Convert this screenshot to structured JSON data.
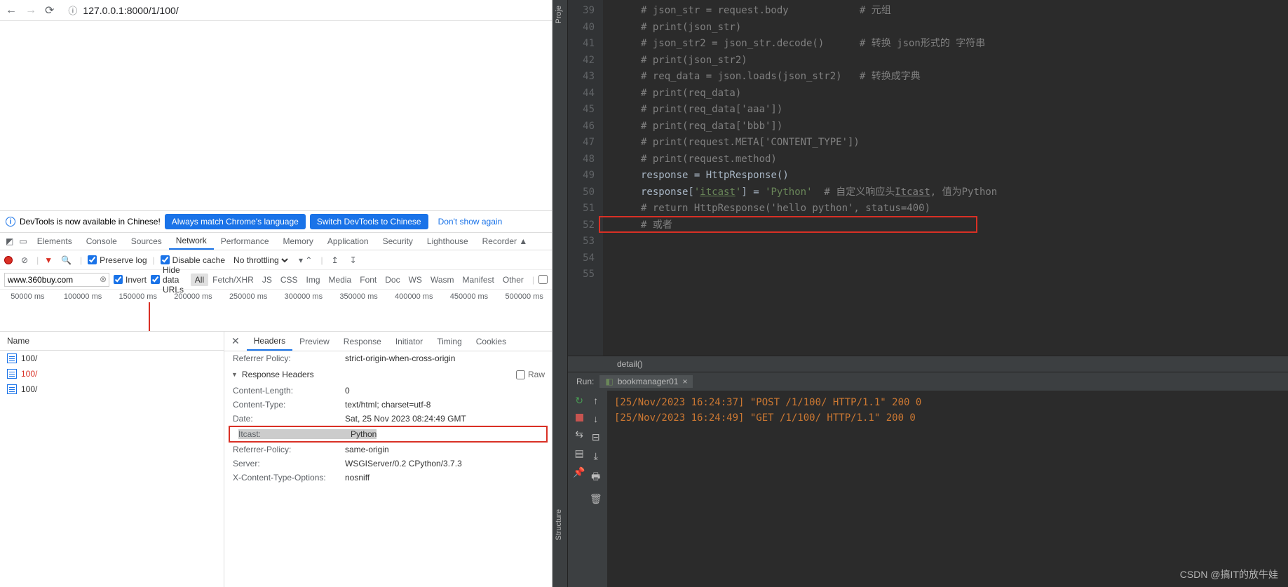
{
  "browser": {
    "url": "127.0.0.1:8000/1/100/"
  },
  "notice": {
    "text": "DevTools is now available in Chinese!",
    "btn1": "Always match Chrome's language",
    "btn2": "Switch DevTools to Chinese",
    "btn3": "Don't show again"
  },
  "devtools_tabs": [
    "Elements",
    "Console",
    "Sources",
    "Network",
    "Performance",
    "Memory",
    "Application",
    "Security",
    "Lighthouse",
    "Recorder ▲"
  ],
  "active_tab": "Network",
  "net_toolbar": {
    "preserve": "Preserve log",
    "disable_cache": "Disable cache",
    "throttling": "No throttling"
  },
  "filter": {
    "value": "www.360buy.com",
    "invert": "Invert",
    "hide": "Hide data URLs",
    "types": [
      "All",
      "Fetch/XHR",
      "JS",
      "CSS",
      "Img",
      "Media",
      "Font",
      "Doc",
      "WS",
      "Wasm",
      "Manifest",
      "Other"
    ],
    "active_type": "All"
  },
  "timeline": [
    "50000 ms",
    "100000 ms",
    "150000 ms",
    "200000 ms",
    "250000 ms",
    "300000 ms",
    "350000 ms",
    "400000 ms",
    "450000 ms",
    "500000 ms"
  ],
  "net_list": {
    "header": "Name",
    "rows": [
      {
        "name": "100/",
        "red": false
      },
      {
        "name": "100/",
        "red": true
      },
      {
        "name": "100/",
        "red": false
      }
    ]
  },
  "detail_tabs": [
    "Headers",
    "Preview",
    "Response",
    "Initiator",
    "Timing",
    "Cookies"
  ],
  "active_detail": "Headers",
  "headers": {
    "top": [
      {
        "k": "Referrer Policy:",
        "v": "strict-origin-when-cross-origin"
      }
    ],
    "section": "Response Headers",
    "raw": "Raw",
    "rows": [
      {
        "k": "Content-Length:",
        "v": "0"
      },
      {
        "k": "Content-Type:",
        "v": "text/html; charset=utf-8"
      },
      {
        "k": "Date:",
        "v": "Sat, 25 Nov 2023 08:24:49 GMT"
      },
      {
        "k": "Itcast:",
        "v": "Python",
        "boxed": true
      },
      {
        "k": "Referrer-Policy:",
        "v": "same-origin"
      },
      {
        "k": "Server:",
        "v": "WSGIServer/0.2 CPython/3.7.3"
      },
      {
        "k": "X-Content-Type-Options:",
        "v": "nosniff"
      }
    ]
  },
  "ide": {
    "side_top": "Proje",
    "side_bottom": "Structure",
    "lines": [
      {
        "n": 39,
        "t": "# json_str = request.body            # 元组"
      },
      {
        "n": 40,
        "t": "# print(json_str)"
      },
      {
        "n": 41,
        "t": "# json_str2 = json_str.decode()      # 转换 json形式的 字符串"
      },
      {
        "n": 42,
        "t": "# print(json_str2)"
      },
      {
        "n": 43,
        "t": "# req_data = json.loads(json_str2)   # 转换成字典"
      },
      {
        "n": 44,
        "t": "# print(req_data)"
      },
      {
        "n": 45,
        "t": "# print(req_data['aaa'])"
      },
      {
        "n": 46,
        "t": "# print(req_data['bbb'])"
      },
      {
        "n": 47,
        "t": ""
      },
      {
        "n": 48,
        "t": "# print(request.META['CONTENT_TYPE'])"
      },
      {
        "n": 49,
        "t": "# print(request.method)"
      },
      {
        "n": 50,
        "t": ""
      },
      {
        "n": 51,
        "t": "response = HttpResponse()"
      },
      {
        "n": 52,
        "t": "response['itcast'] = 'Python'  # 自定义响应头Itcast, 值为Python",
        "boxed": true,
        "code": true
      },
      {
        "n": 53,
        "t": ""
      },
      {
        "n": 54,
        "t": "# return HttpResponse('hello python', status=400)"
      },
      {
        "n": 55,
        "t": "# 或者"
      }
    ],
    "breadcrumb": "detail()",
    "run_label": "Run:",
    "run_tab": "bookmanager01",
    "console": [
      "[25/Nov/2023 16:24:37] \"POST /1/100/ HTTP/1.1\" 200 0",
      "[25/Nov/2023 16:24:49] \"GET /1/100/ HTTP/1.1\" 200 0"
    ]
  },
  "watermark": "CSDN @搞IT的放牛娃"
}
